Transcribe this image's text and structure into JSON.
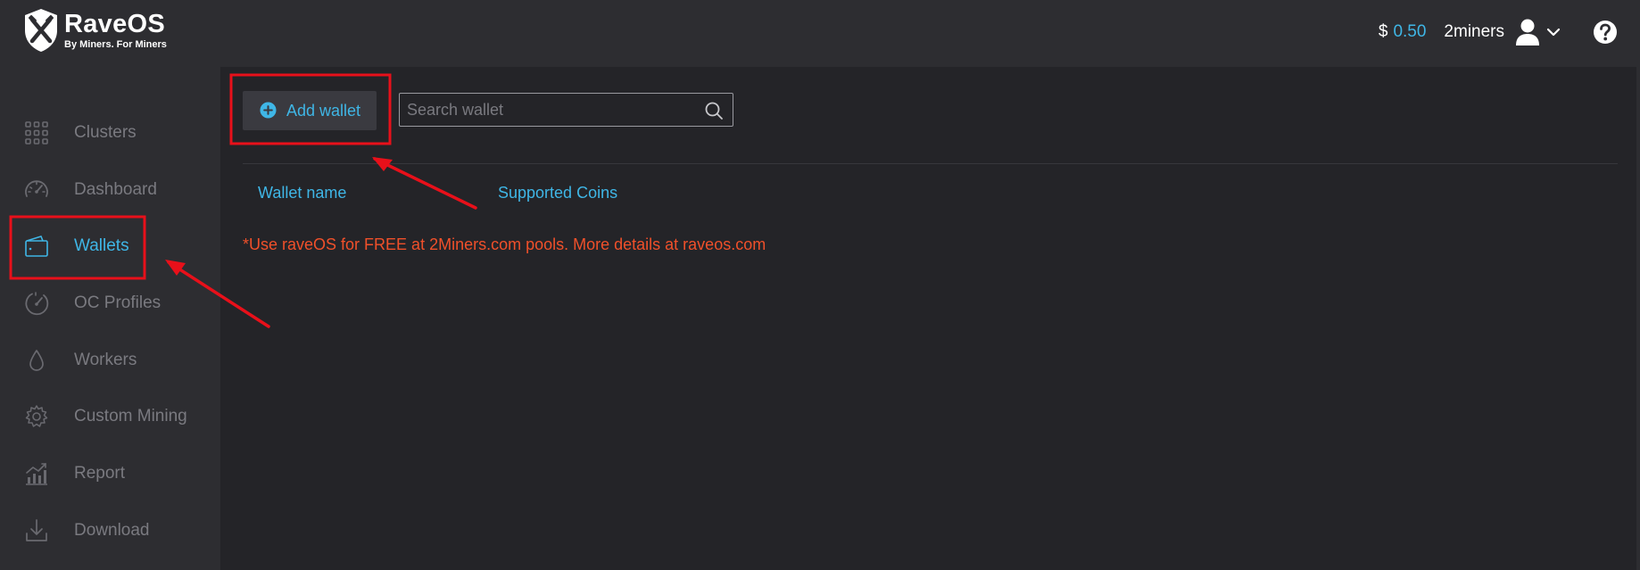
{
  "brand": {
    "title": "RaveOS",
    "tagline": "By Miners. For Miners"
  },
  "header": {
    "currency_symbol": "$",
    "balance": "0.50",
    "username": "2miners",
    "icons": [
      "user-avatar-icon",
      "chevron-down-icon",
      "help-icon"
    ]
  },
  "sidebar": {
    "items": [
      {
        "label": "Clusters",
        "icon": "grid-icon",
        "active": false
      },
      {
        "label": "Dashboard",
        "icon": "speedometer-icon",
        "active": false
      },
      {
        "label": "Wallets",
        "icon": "wallet-icon",
        "active": true
      },
      {
        "label": "OC Profiles",
        "icon": "gauge-icon",
        "active": false
      },
      {
        "label": "Workers",
        "icon": "drop-icon",
        "active": false
      },
      {
        "label": "Custom Mining",
        "icon": "gear-icon",
        "active": false
      },
      {
        "label": "Report",
        "icon": "chart-icon",
        "active": false
      },
      {
        "label": "Download",
        "icon": "download-icon",
        "active": false
      }
    ]
  },
  "toolbar": {
    "add_wallet_label": "Add wallet",
    "search_placeholder": "Search wallet"
  },
  "table": {
    "columns": [
      "Wallet name",
      "Supported Coins"
    ]
  },
  "notice": "*Use raveOS for FREE at 2Miners.com pools. More details at raveos.com",
  "colors": {
    "accent": "#3fb6e6",
    "notice": "#f0502a",
    "annotation": "#e8101a"
  }
}
